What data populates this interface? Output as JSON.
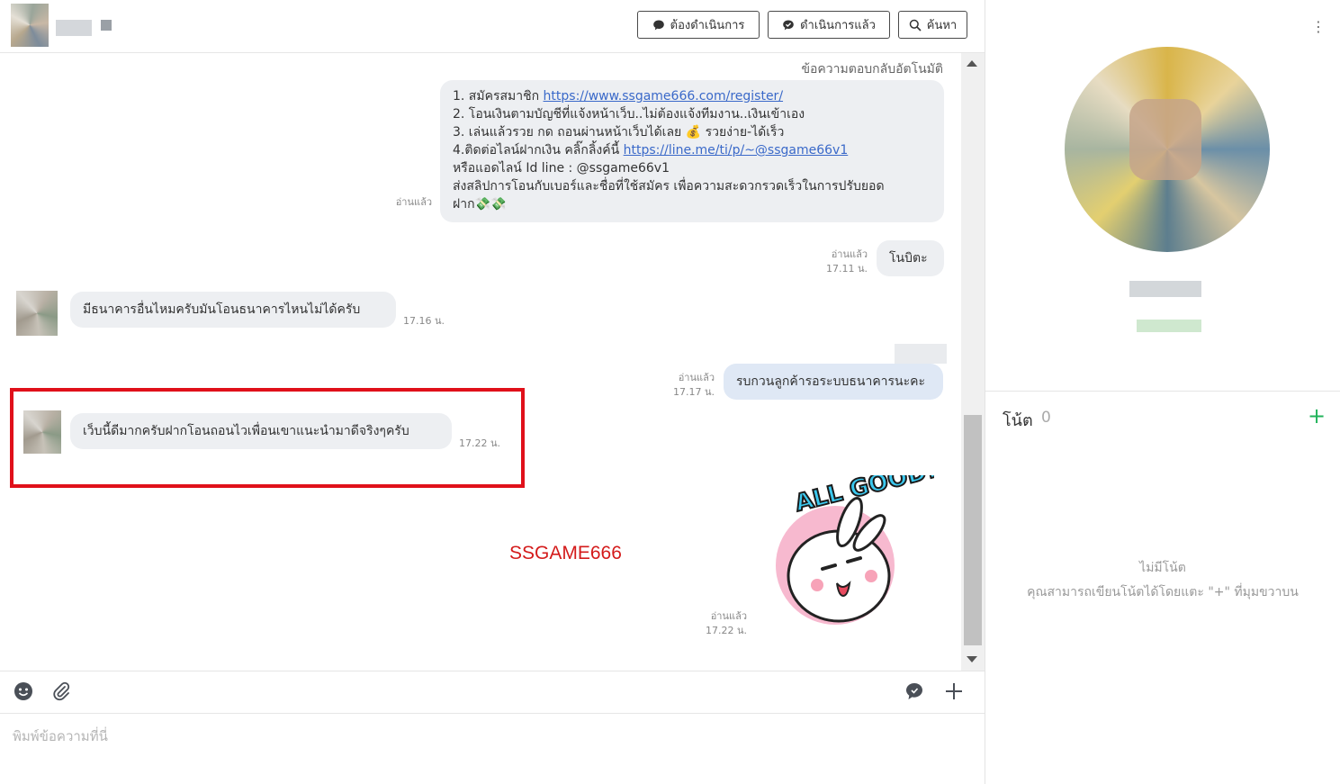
{
  "header": {
    "buttons": [
      {
        "label": "ต้องดำเนินการ",
        "icon": "chat-bubble-icon"
      },
      {
        "label": "ดำเนินการแล้ว",
        "icon": "chat-check-icon"
      },
      {
        "label": "ค้นหา",
        "icon": "search-icon"
      }
    ]
  },
  "chat": {
    "auto_reply_label": "ข้อความตอบกลับอัตโนมัติ",
    "auto_reply": {
      "read": "อ่านแล้ว",
      "line1_prefix": "1. สมัครสมาชิก ",
      "line1_link": "https://www.ssgame666.com/register/",
      "line2": "2. โอนเงินตามบัญชีที่แจ้งหน้าเว็บ..ไม่ต้องแจ้งทีมงาน..เงินเข้าเอง",
      "line3": "3. เล่นแล้วรวย กด ถอนผ่านหน้าเว็บได้เลย 💰 รวยง่าย-ได้เร็ว",
      "line4_prefix": "4.ติดต่อไลน์ฝากเงิน คลิ๊กลิ้งค์นี้  ",
      "line4_link": "https://line.me/ti/p/~@ssgame66v1",
      "line5": "หรือแอดไลน์ Id line : @ssgame66v1",
      "line6": "ส่งสลิปการโอนกับเบอร์และชื่อที่ใช้สมัคร เพื่อความสะดวกรวดเร็วในการปรับยอด",
      "line7": "ฝาก💸💸"
    },
    "messages": [
      {
        "text": "โนบิตะ",
        "read": "อ่านแล้ว",
        "time": "17.11 น."
      },
      {
        "text": "มีธนาคารอื่นไหมครับมันโอนธนาคารไหนไม่ได้ครับ",
        "time": "17.16 น."
      },
      {
        "text": "รบกวนลูกค้ารอระบบธนาคารนะคะ",
        "read": "อ่านแล้ว",
        "time": "17.17 น."
      },
      {
        "text": "เว็บนี้ดีมากครับฝากโอนถอนไวเพื่อนเขาแนะนำมาดีจริงๆครับ",
        "time": "17.22 น."
      },
      {
        "sticker": "ALL GOOD!",
        "read": "อ่านแล้ว",
        "time": "17.22 น."
      }
    ],
    "watermark": "SSGAME666"
  },
  "compose": {
    "placeholder": "พิมพ์ข้อความที่นี่"
  },
  "side": {
    "notes_title": "โน้ต",
    "notes_count": "0",
    "notes_add": "+",
    "empty_title": "ไม่มีโน้ต",
    "empty_hint": "คุณสามารถเขียนโน้ตได้โดยแตะ \"+\" ที่มุมขวาบน"
  },
  "colors": {
    "highlight": "#e0101a",
    "accent_green": "#21b35a",
    "link": "#3a69c9",
    "bubble_incoming": "#edeff2",
    "bubble_outgoing": "#dfe8f5"
  }
}
